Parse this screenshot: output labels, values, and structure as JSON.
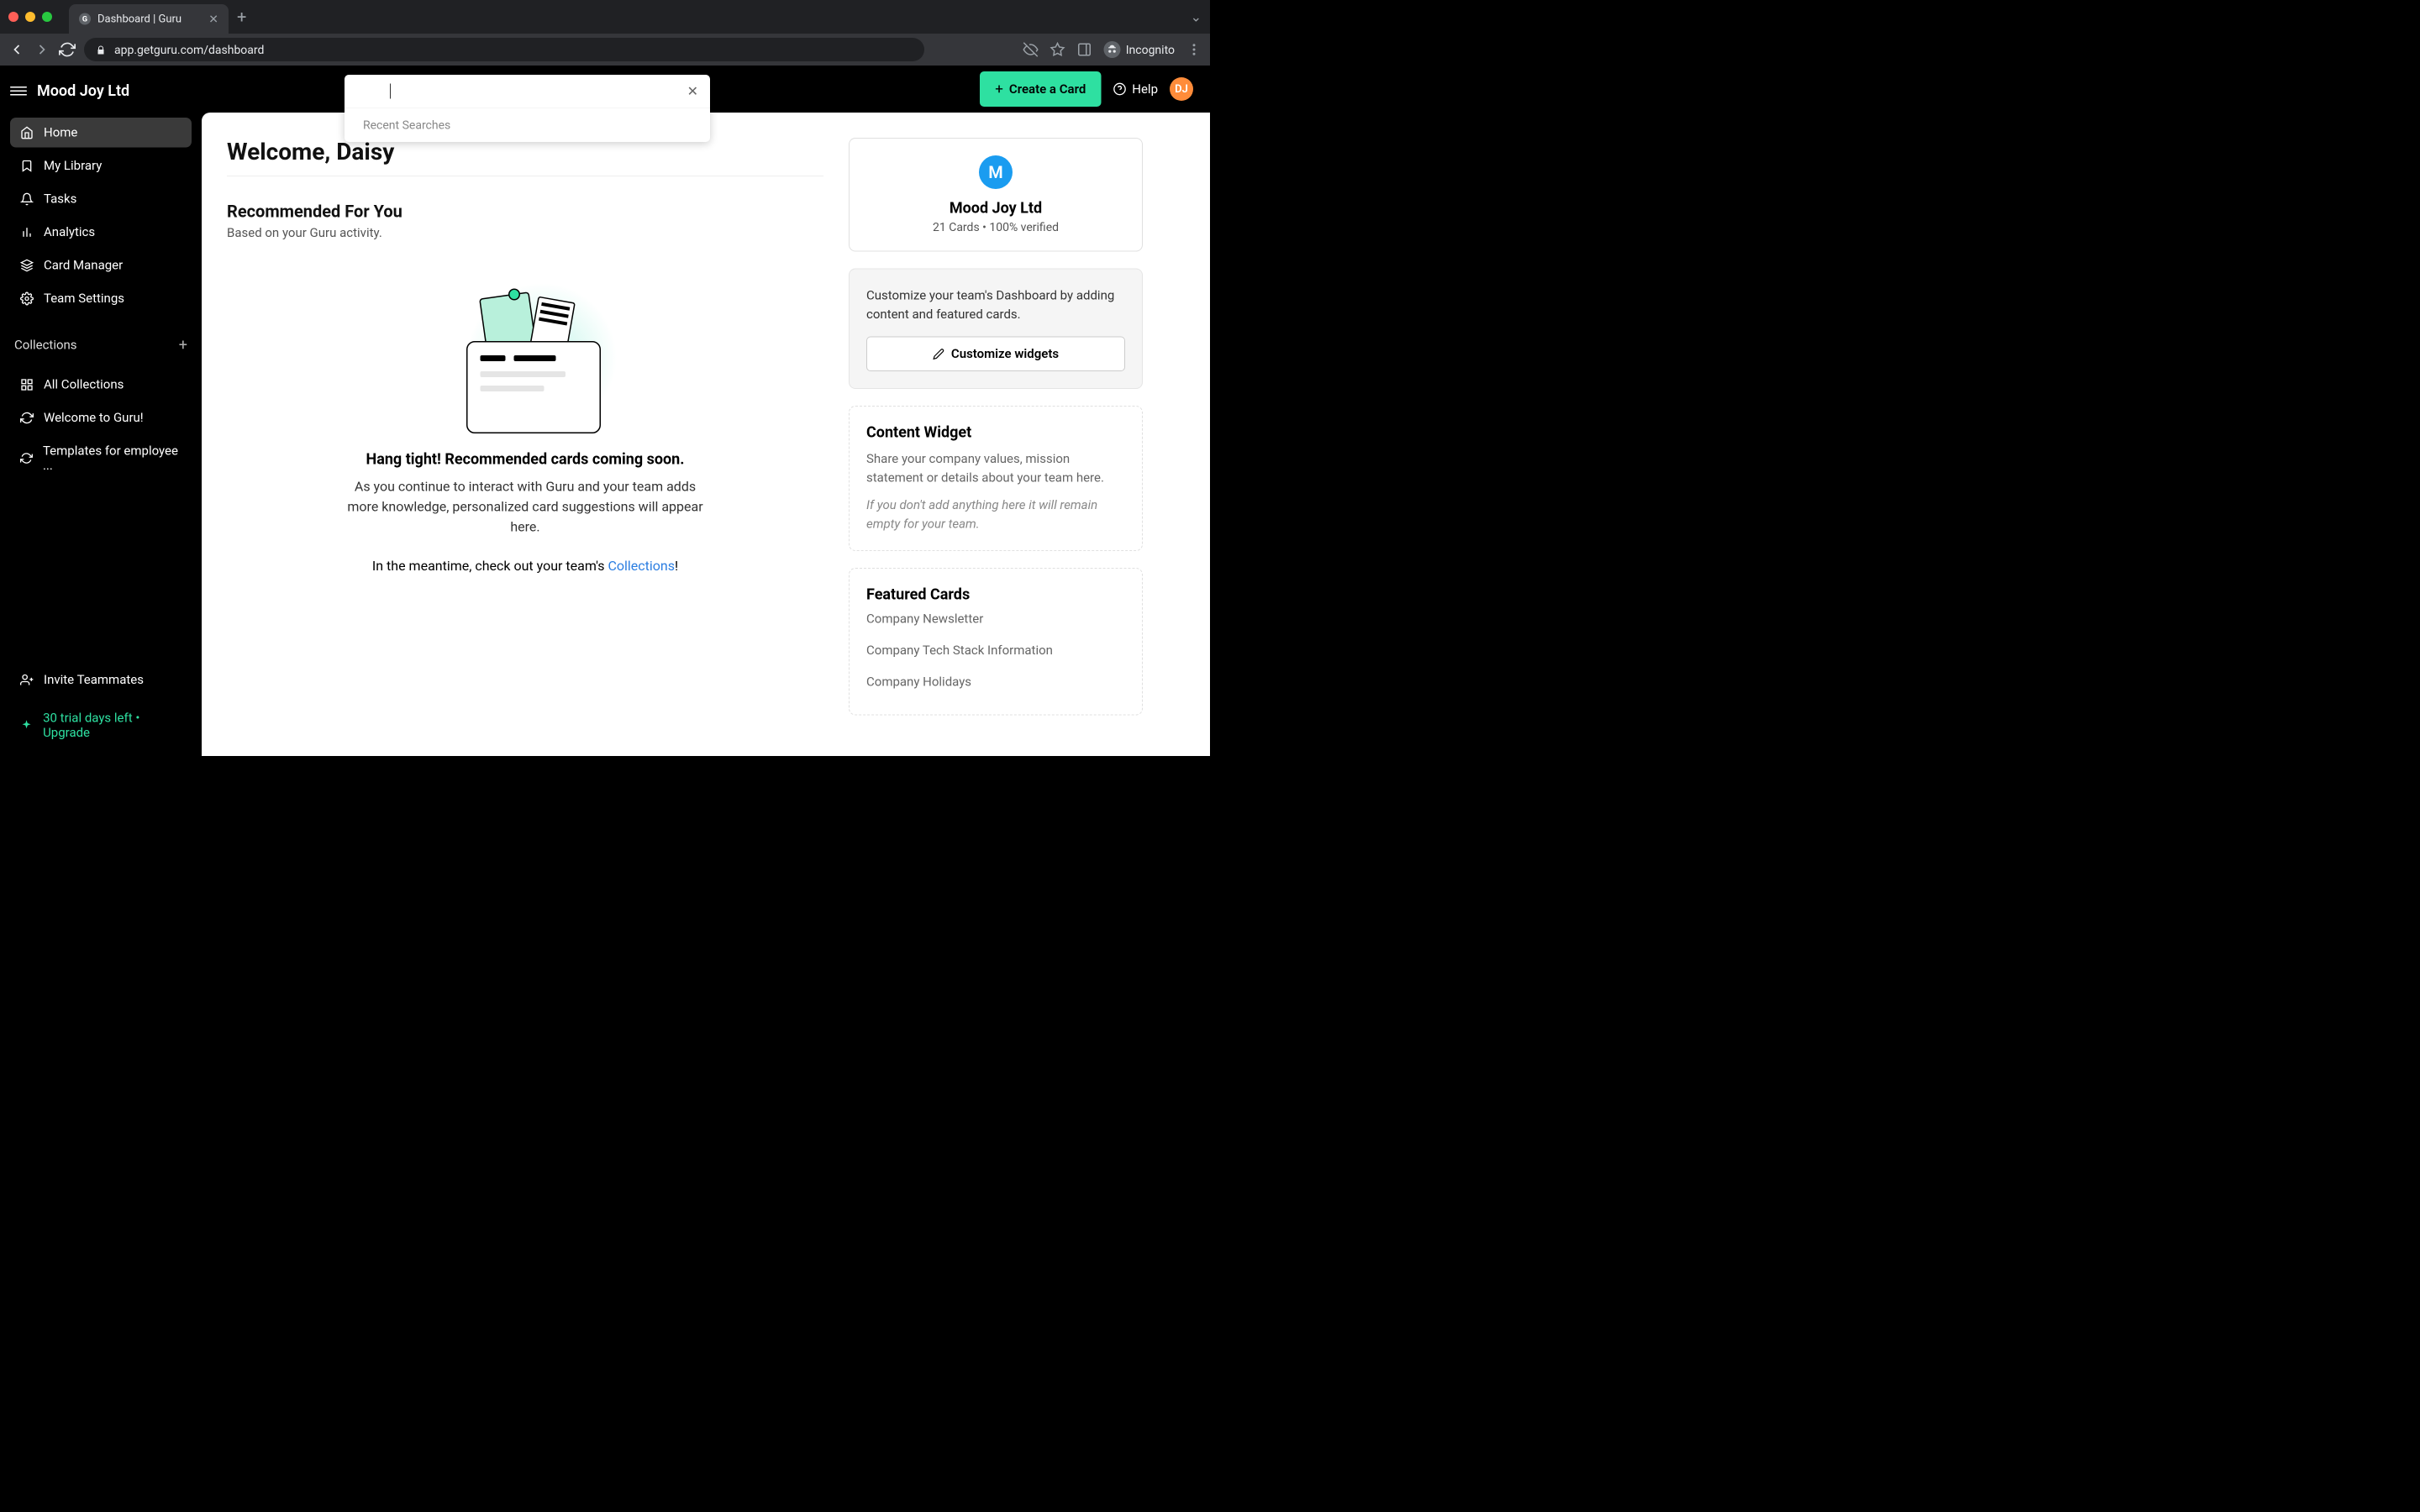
{
  "browser": {
    "tab_title": "Dashboard | Guru",
    "favicon_letter": "G",
    "url": "app.getguru.com/dashboard",
    "incognito_label": "Incognito"
  },
  "header": {
    "org_name": "Mood Joy Ltd",
    "create_button": "Create a Card",
    "help_label": "Help",
    "avatar_initials": "DJ"
  },
  "search": {
    "recent_label": "Recent Searches"
  },
  "sidebar": {
    "nav": [
      {
        "label": "Home",
        "icon": "home",
        "active": true
      },
      {
        "label": "My Library",
        "icon": "bookmark",
        "active": false
      },
      {
        "label": "Tasks",
        "icon": "bell",
        "active": false
      },
      {
        "label": "Analytics",
        "icon": "bars",
        "active": false
      },
      {
        "label": "Card Manager",
        "icon": "layers",
        "active": false
      },
      {
        "label": "Team Settings",
        "icon": "gear",
        "active": false
      }
    ],
    "collections_header": "Collections",
    "collections": [
      {
        "label": "All Collections",
        "icon": "grid"
      },
      {
        "label": "Welcome to Guru!",
        "icon": "refresh"
      },
      {
        "label": "Templates for employee ...",
        "icon": "refresh"
      }
    ],
    "invite_label": "Invite Teammates",
    "trial_label": "30 trial days left • Upgrade"
  },
  "main": {
    "welcome": "Welcome, Daisy",
    "recommended_title": "Recommended For You",
    "recommended_subtitle": "Based on your Guru activity.",
    "empty_title": "Hang tight! Recommended cards coming soon.",
    "empty_desc": "As you continue to interact with Guru and your team adds more knowledge, personalized card suggestions will appear here.",
    "empty_link_prefix": "In the meantime, check out your team's ",
    "empty_link_text": "Collections",
    "empty_link_suffix": "!"
  },
  "right": {
    "team_badge_letter": "M",
    "team_name": "Mood Joy Ltd",
    "team_stats": "21 Cards • 100% verified",
    "customize_desc": "Customize your team's Dashboard by adding content and featured cards.",
    "customize_btn": "Customize widgets",
    "content_widget_title": "Content Widget",
    "content_widget_desc": "Share your company values, mission statement or details about your team here.",
    "content_widget_note": "If you don't add anything here it will remain empty for your team.",
    "featured_title": "Featured Cards",
    "featured_items": [
      "Company Newsletter",
      "Company Tech Stack Information",
      "Company Holidays"
    ]
  }
}
